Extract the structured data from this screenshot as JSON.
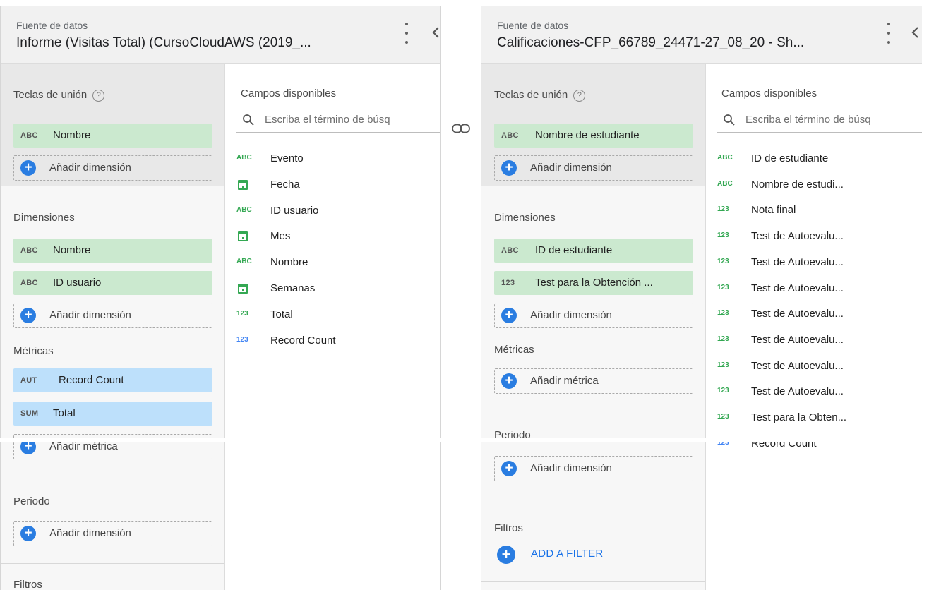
{
  "left": {
    "header": {
      "label": "Fuente de datos",
      "title": "Informe (Visitas Total) (CursoCloudAWS (2019_..."
    },
    "join_title": "Teclas de unión",
    "join_keys": [
      {
        "icon": "ABC",
        "label": "Nombre"
      }
    ],
    "add_dimension": "Añadir dimensión",
    "dimensions_title": "Dimensiones",
    "dimensions": [
      {
        "icon": "ABC",
        "label": "Nombre"
      },
      {
        "icon": "ABC",
        "label": "ID usuario"
      }
    ],
    "metrics_title": "Métricas",
    "metrics": [
      {
        "icon": "AUT",
        "label": "Record Count"
      },
      {
        "icon": "SUM",
        "label": "Total"
      }
    ],
    "add_metric": "Añadir métrica",
    "period_title": "Periodo",
    "filters_title": "Filtros",
    "available_title": "Campos disponibles",
    "search_placeholder": "Escriba el término de búsq",
    "fields": [
      {
        "type": "abc",
        "icon": "ABC",
        "label": "Evento"
      },
      {
        "type": "date",
        "icon": "calendar-icon",
        "label": "Fecha"
      },
      {
        "type": "abc",
        "icon": "ABC",
        "label": "ID usuario"
      },
      {
        "type": "date",
        "icon": "calendar-icon",
        "label": "Mes"
      },
      {
        "type": "abc",
        "icon": "ABC",
        "label": "Nombre"
      },
      {
        "type": "date",
        "icon": "calendar-icon",
        "label": "Semanas"
      },
      {
        "type": "num",
        "icon": "123",
        "label": "Total"
      },
      {
        "type": "num-blue",
        "icon": "123",
        "label": "Record Count"
      }
    ]
  },
  "right": {
    "header": {
      "label": "Fuente de datos",
      "title": "Calificaciones-CFP_66789_24471-27_08_20 - Sh..."
    },
    "join_title": "Teclas de unión",
    "join_keys": [
      {
        "icon": "ABC",
        "label": "Nombre de estudiante"
      }
    ],
    "add_dimension": "Añadir dimensión",
    "dimensions_title": "Dimensiones",
    "dimensions": [
      {
        "icon": "ABC",
        "label": "ID de estudiante"
      },
      {
        "icon": "123",
        "label": "Test para la Obtención ..."
      }
    ],
    "metrics_title": "Métricas",
    "add_metric": "Añadir métrica",
    "period_title": "Periodo",
    "filters_title": "Filtros",
    "add_filter": "ADD A FILTER",
    "available_title": "Campos disponibles",
    "search_placeholder": "Escriba el término de búsq",
    "fields": [
      {
        "type": "abc",
        "icon": "ABC",
        "label": "ID de estudiante"
      },
      {
        "type": "abc",
        "icon": "ABC",
        "label": "Nombre de estudi..."
      },
      {
        "type": "num",
        "icon": "123",
        "label": "Nota final"
      },
      {
        "type": "num",
        "icon": "123",
        "label": "Test de Autoevalu..."
      },
      {
        "type": "num",
        "icon": "123",
        "label": "Test de Autoevalu..."
      },
      {
        "type": "num",
        "icon": "123",
        "label": "Test de Autoevalu..."
      },
      {
        "type": "num",
        "icon": "123",
        "label": "Test de Autoevalu..."
      },
      {
        "type": "num",
        "icon": "123",
        "label": "Test de Autoevalu..."
      },
      {
        "type": "num",
        "icon": "123",
        "label": "Test de Autoevalu..."
      },
      {
        "type": "num",
        "icon": "123",
        "label": "Test de Autoevalu..."
      },
      {
        "type": "num",
        "icon": "123",
        "label": "Test para la Obten..."
      },
      {
        "type": "num-blue",
        "icon": "123",
        "label": "Record Count"
      }
    ]
  },
  "colors": {
    "dimension_chip": "#cbe9cf",
    "metric_chip": "#bde0fb",
    "accent": "#2a7de1",
    "link": "#1a73e8"
  }
}
